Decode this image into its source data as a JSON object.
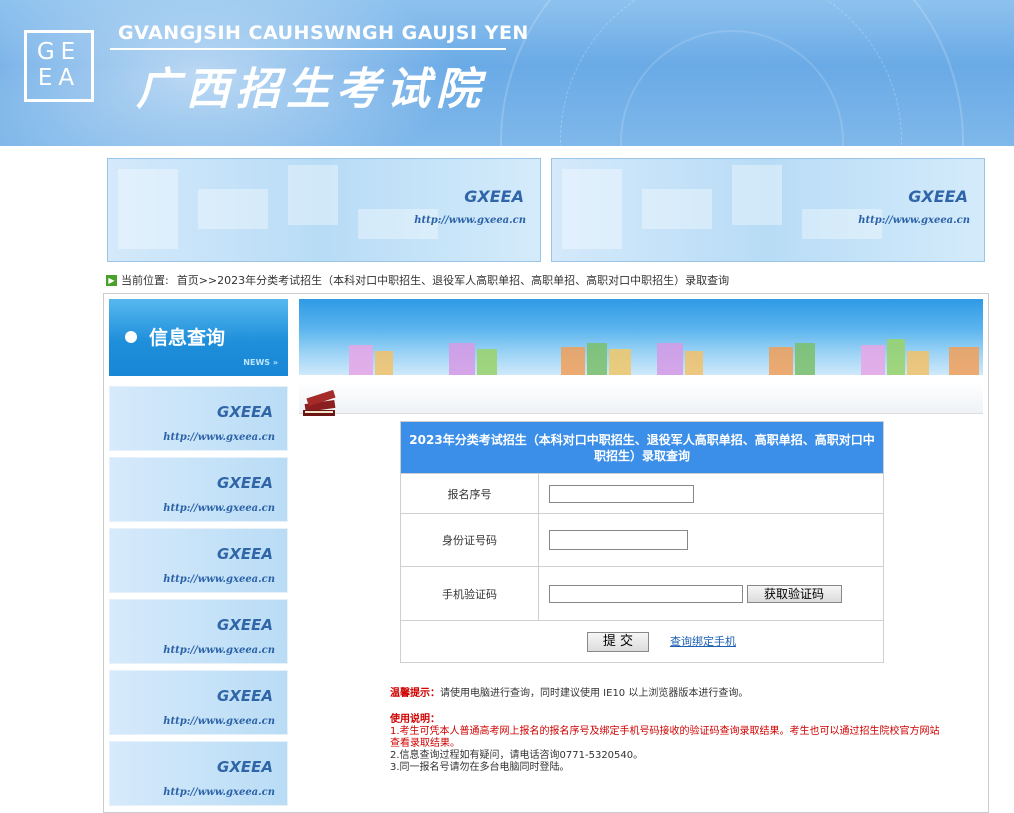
{
  "header": {
    "logo_lines": [
      "GE",
      "EA"
    ],
    "title_en": "GVANGJSIH CAUHSWNGH GAUJSI YEN",
    "title_cn": "广西招生考试院"
  },
  "banners": [
    {
      "brand": "GXEEA",
      "url": "http://www.gxeea.cn"
    },
    {
      "brand": "GXEEA",
      "url": "http://www.gxeea.cn"
    }
  ],
  "breadcrumb": {
    "label": "当前位置:",
    "path": "首页>>2023年分类考试招生（本科对口中职招生、退役军人高职单招、高职单招、高职对口中职招生）录取查询"
  },
  "sidebar": {
    "heading": "信息查询",
    "news": "NEWS »",
    "items": [
      {
        "brand": "GXEEA",
        "url": "http://www.gxeea.cn"
      },
      {
        "brand": "GXEEA",
        "url": "http://www.gxeea.cn"
      },
      {
        "brand": "GXEEA",
        "url": "http://www.gxeea.cn"
      },
      {
        "brand": "GXEEA",
        "url": "http://www.gxeea.cn"
      },
      {
        "brand": "GXEEA",
        "url": "http://www.gxeea.cn"
      },
      {
        "brand": "GXEEA",
        "url": "http://www.gxeea.cn"
      }
    ]
  },
  "form": {
    "title": "2023年分类考试招生（本科对口中职招生、退役军人高职单招、高职单招、高职对口中职招生）录取查询",
    "reg_label": "报名序号",
    "reg_value": "",
    "id_label": "身份证号码",
    "id_value": "",
    "sms_label": "手机验证码",
    "sms_value": "",
    "get_code_button": "获取验证码",
    "submit_button": "提 交",
    "query_phone_link": "查询绑定手机"
  },
  "tips": {
    "warm_label": "温馨提示：",
    "warm_text": "请使用电脑进行查询，同时建议使用 IE10 以上浏览器版本进行查询。",
    "usage_label": "使用说明：",
    "usage_1": "1.考生可凭本人普通高考网上报名的报名序号及绑定手机号码接收的验证码查询录取结果。考生也可以通过招生院校官方网站查看录取结果。",
    "usage_2": "2.信息查询过程如有疑问，请电话咨询0771-5320540。",
    "usage_3": "3.同一报名号请勿在多台电脑同时登陆。"
  },
  "colors": {
    "header_blue": "#6aaae6",
    "form_head": "#3b8fe8",
    "warning_red": "#d00000",
    "link_blue": "#1a5fb4"
  }
}
